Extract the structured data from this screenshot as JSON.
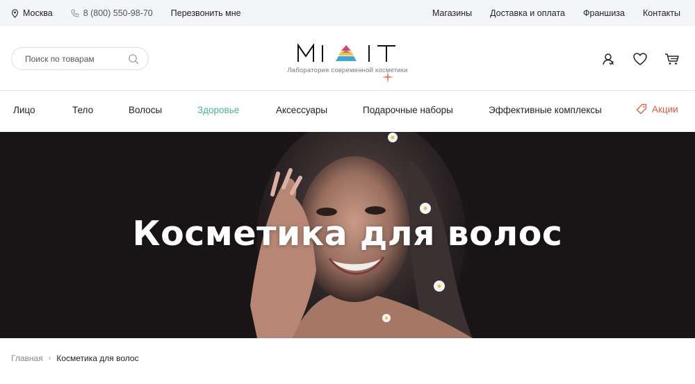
{
  "topbar": {
    "city": "Москва",
    "phone": "8 (800) 550-98-70",
    "callback": "Перезвонить мне",
    "links": [
      "Магазины",
      "Доставка и оплата",
      "Франшиза",
      "Контакты"
    ]
  },
  "header": {
    "search_placeholder": "Поиск по товарам",
    "logo_text": "MIXIT",
    "logo_tagline": "Лаборатория современной косметики",
    "icons": [
      "user-icon",
      "heart-icon",
      "cart-icon"
    ]
  },
  "nav": {
    "categories": [
      "Лицо",
      "Тело",
      "Волосы",
      "Здоровье",
      "Аксессуары",
      "Подарочные наборы",
      "Эффективные комплексы"
    ],
    "active": "Здоровье",
    "promo": "Акции"
  },
  "hero": {
    "title": "Косметика для волос"
  },
  "breadcrumb": {
    "home": "Главная",
    "separator": "›",
    "current": "Косметика для волос"
  },
  "colors": {
    "accent_green": "#4bb58a",
    "promo_red": "#e4573c",
    "topbar_bg": "#f4f5f9",
    "hero_bg": "#1a1618"
  }
}
